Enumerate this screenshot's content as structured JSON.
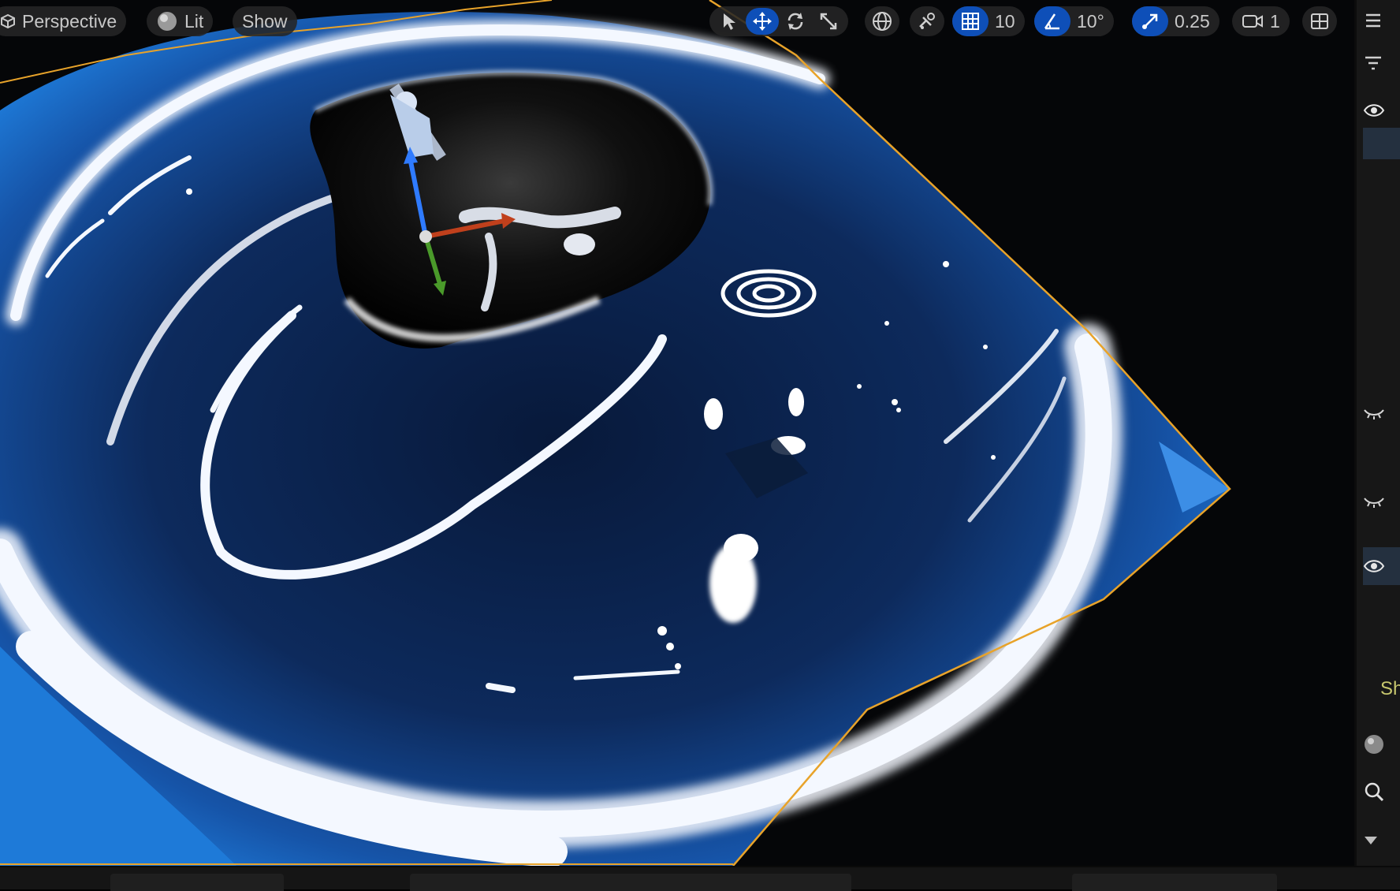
{
  "viewport": {
    "view_mode": "Perspective",
    "lighting_mode": "Lit",
    "show_menu": "Show",
    "icons": {
      "view_mode": "cube-icon",
      "lighting_mode": "sphere-icon"
    }
  },
  "toolbar": {
    "transform_tools": [
      {
        "name": "select-tool",
        "icon": "cursor-icon",
        "active": false
      },
      {
        "name": "translate-tool",
        "icon": "move-arrows-icon",
        "active": true
      },
      {
        "name": "rotate-tool",
        "icon": "rotate-icon",
        "active": false
      },
      {
        "name": "scale-tool",
        "icon": "scale-icon",
        "active": false
      }
    ],
    "coordinate_space_icon": "globe-icon",
    "surface_snapping_icon": "surface-snap-icon",
    "grid_snap_value": "10",
    "rotation_snap_value": "10°",
    "scale_snap_value": "0.25",
    "camera_speed_value": "1",
    "layout_icon": "viewport-layout-icon"
  },
  "right_panel": {
    "partial_text": "Sh",
    "icons": [
      "hamburger-icon",
      "filter-icon",
      "eye-icon",
      "eye-closed-icon",
      "eye-closed-icon",
      "eye-icon",
      "globe-icon",
      "search-icon",
      "triangle-down-icon"
    ]
  },
  "colors": {
    "accent_blue": "#0e4fb8",
    "selection_outline": "#e8a32a",
    "toolbar_bg": "#262626",
    "panel_bg": "#171717",
    "water_deep": "#0d2a5c",
    "water_light": "#1a6fd0"
  }
}
